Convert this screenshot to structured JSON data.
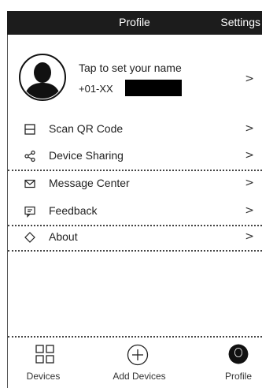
{
  "header": {
    "title": "Profile",
    "settings_label": "Settings"
  },
  "profile": {
    "name_prompt": "Tap to set your name",
    "phone_prefix": "+01-XX",
    "chevron": ">"
  },
  "menu": [
    {
      "label": "Scan QR Code",
      "icon": "qr-scan-icon",
      "chevron": ">"
    },
    {
      "label": "Device Sharing",
      "icon": "share-icon",
      "chevron": ">"
    },
    {
      "label": "Message Center",
      "icon": "mail-icon",
      "chevron": ">"
    },
    {
      "label": "Feedback",
      "icon": "feedback-icon",
      "chevron": ">"
    },
    {
      "label": "About",
      "icon": "diamond-icon",
      "chevron": ">"
    }
  ],
  "tabbar": {
    "devices": "Devices",
    "add_devices": "Add Devices",
    "profile": "Profile"
  },
  "colors": {
    "header_bg": "#1c1c1c",
    "text": "#222222",
    "redaction": "#000000"
  }
}
